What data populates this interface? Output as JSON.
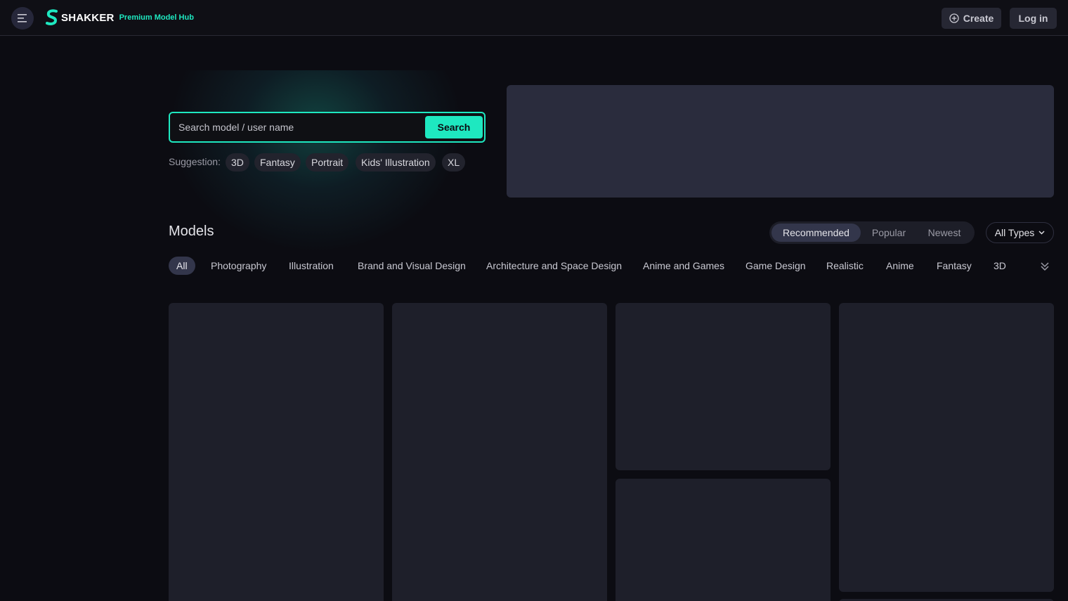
{
  "header": {
    "logo_word": "SHAKKER",
    "logo_tagline": "Premium Model Hub",
    "create_label": "Create",
    "login_label": "Log in"
  },
  "hero": {
    "search_placeholder": "Search model / user name",
    "search_button": "Search",
    "suggestion_label": "Suggestion:",
    "suggestions": [
      "3D",
      "Fantasy",
      "Portrait",
      "Kids' Illustration",
      "XL"
    ]
  },
  "models": {
    "title": "Models",
    "sort_tabs": [
      "Recommended",
      "Popular",
      "Newest"
    ],
    "active_sort": "Recommended",
    "type_filter": "All Types",
    "categories": [
      "All",
      "Photography",
      "Illustration",
      "Brand and Visual Design",
      "Architecture and Space Design",
      "Anime and Games",
      "Game Design",
      "Realistic",
      "Anime",
      "Fantasy",
      "3D"
    ],
    "active_category": "All"
  },
  "colors": {
    "accent": "#1ee8c0",
    "background": "#0c0c12",
    "card": "#1e1f2a",
    "banner": "#2a2c3d"
  },
  "icons": [
    "menu-icon",
    "logo-icon",
    "plus-circle-icon",
    "chevron-down-icon",
    "double-chevron-down-icon"
  ]
}
